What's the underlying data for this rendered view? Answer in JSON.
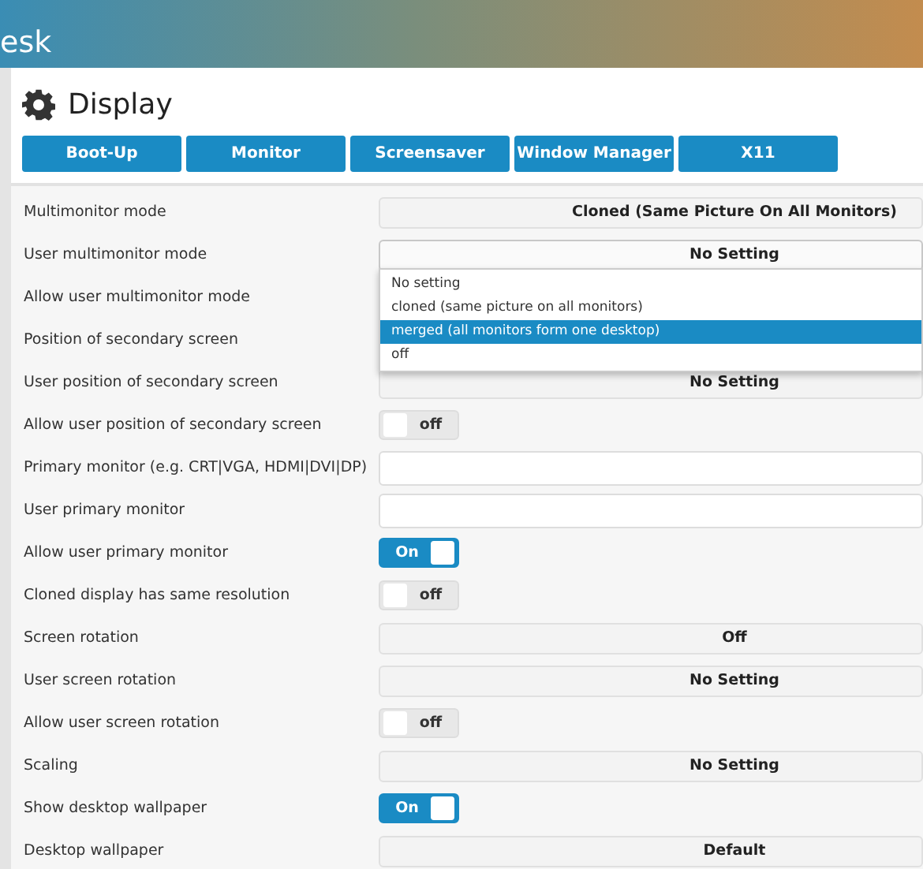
{
  "header": {
    "title": "esk"
  },
  "page": {
    "title": "Display"
  },
  "tabs": [
    {
      "label": "Boot-Up",
      "selected": false
    },
    {
      "label": "Monitor",
      "selected": false
    },
    {
      "label": "Screensaver",
      "selected": false
    },
    {
      "label": "Window Manager",
      "selected": false
    },
    {
      "label": "X11",
      "selected": false
    }
  ],
  "settings": [
    {
      "label": "Multimonitor mode",
      "kind": "select",
      "value": "Cloned (Same Picture On All Monitors)"
    },
    {
      "label": "User multimonitor mode",
      "kind": "select",
      "value": "No Setting",
      "expanded": true,
      "options": [
        {
          "label": "No setting",
          "selected": false
        },
        {
          "label": "cloned (same picture on all monitors)",
          "selected": false
        },
        {
          "label": "merged (all monitors form one desktop)",
          "selected": true
        },
        {
          "label": "off",
          "selected": false
        }
      ]
    },
    {
      "label": "Allow user multimonitor mode",
      "kind": "covered"
    },
    {
      "label": "Position of secondary screen",
      "kind": "covered"
    },
    {
      "label": "User position of secondary screen",
      "kind": "select",
      "value": "No Setting"
    },
    {
      "label": "Allow user position of secondary screen",
      "kind": "toggle",
      "on": false,
      "text": "off"
    },
    {
      "label": "Primary monitor (e.g. CRT|VGA, HDMI|DVI|DP)",
      "kind": "text"
    },
    {
      "label": "User primary monitor",
      "kind": "text"
    },
    {
      "label": "Allow user primary monitor",
      "kind": "toggle",
      "on": true,
      "text": "On"
    },
    {
      "label": "Cloned display has same resolution",
      "kind": "toggle",
      "on": false,
      "text": "off"
    },
    {
      "label": "Screen rotation",
      "kind": "select",
      "value": "Off"
    },
    {
      "label": "User screen rotation",
      "kind": "select",
      "value": "No Setting"
    },
    {
      "label": "Allow user screen rotation",
      "kind": "toggle",
      "on": false,
      "text": "off"
    },
    {
      "label": "Scaling",
      "kind": "select",
      "value": "No Setting"
    },
    {
      "label": "Show desktop wallpaper",
      "kind": "toggle",
      "on": true,
      "text": "On"
    },
    {
      "label": "Desktop wallpaper",
      "kind": "select",
      "value": "Default"
    }
  ]
}
